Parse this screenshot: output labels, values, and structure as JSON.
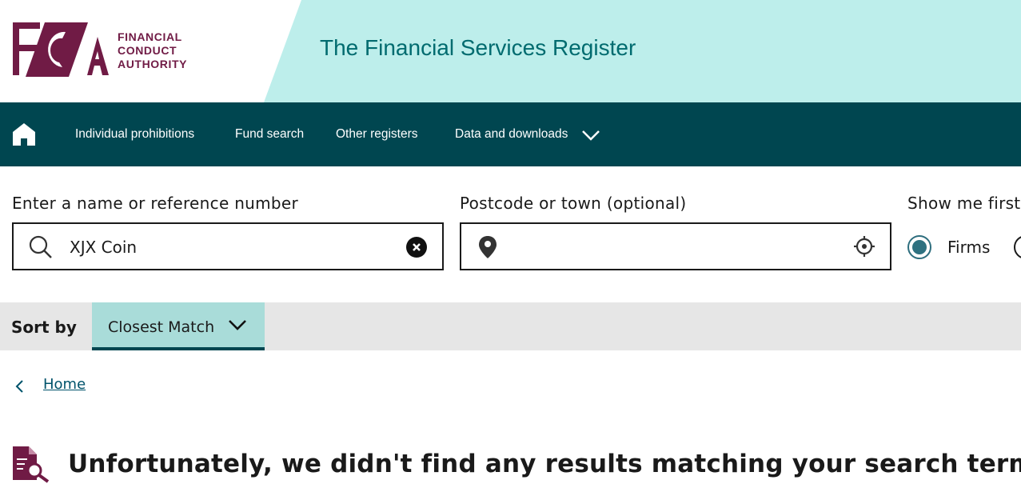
{
  "brand": {
    "logo_letters": "FCA",
    "logo_lines": [
      "FINANCIAL",
      "CONDUCT",
      "AUTHORITY"
    ],
    "primary_color": "#701b45",
    "header_accent": "#bdeeeb"
  },
  "header": {
    "title": "The Financial Services Register"
  },
  "nav": {
    "background": "#004650",
    "home_icon": "home-icon",
    "items": [
      {
        "label": "Individual prohibitions"
      },
      {
        "label": "Fund search"
      },
      {
        "label": "Other registers"
      },
      {
        "label": "Data and downloads",
        "has_dropdown": true
      }
    ]
  },
  "search": {
    "name_label": "Enter a name or reference number",
    "name_value": "XJX Coin",
    "location_label": "Postcode or town (optional)",
    "location_value": "",
    "show_first_label": "Show me first",
    "options": [
      {
        "label": "Firms",
        "selected": true
      }
    ]
  },
  "sort": {
    "label": "Sort by",
    "selected": "Closest Match"
  },
  "breadcrumb": {
    "home_label": "Home"
  },
  "result": {
    "heading": "Unfortunately, we didn't find any results matching your search term"
  }
}
